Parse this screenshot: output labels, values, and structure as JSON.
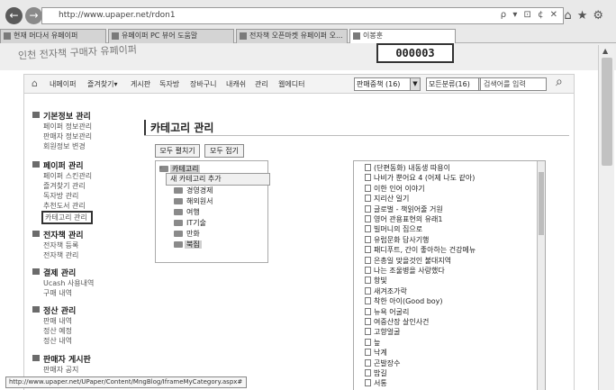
{
  "browser": {
    "url": "http://www.upaper.net/rdon1",
    "address_controls": "ρ ▾ ⊡ ¢ ✕",
    "tabs": [
      {
        "label": "현재 머다서 유페이퍼"
      },
      {
        "label": "유페이퍼 PC 뷰어 도움말"
      },
      {
        "label": "전자책 오픈마켓 유페이퍼 오..."
      },
      {
        "label": "이봉훈"
      }
    ],
    "toolbar_icons": [
      "home-icon",
      "star-icon",
      "gear-icon"
    ]
  },
  "banner": {
    "faded_text": "인천 전자책 구매자 유페이퍼",
    "counter": "000003"
  },
  "menubar": {
    "items": [
      "내페이퍼",
      "즐겨찾기▾",
      "게시판",
      "독자방",
      "장바구니",
      "내캐쉬",
      "관리",
      "웹에디터"
    ],
    "select1": "판매중책 (16)",
    "select2": "모든분류(16)",
    "search_text": "검색어를 입력"
  },
  "sidebar": {
    "sections": [
      {
        "title": "기본정보 관리",
        "items": [
          "페이퍼 정보관리",
          "판매자 정보관리",
          "회원정보 변경"
        ]
      },
      {
        "title": "페이퍼 관리",
        "items": [
          "페이퍼 스킨관리",
          "즐겨찾기 관리",
          "독자방 관리",
          "추천도서 관리",
          "카테고리 관리"
        ]
      },
      {
        "title": "전자책 관리",
        "items": [
          "전자책 등록",
          "전자책 관리"
        ]
      },
      {
        "title": "결제 관리",
        "items": [
          "Ucash 사용내역",
          "구매 내역"
        ]
      },
      {
        "title": "정산 관리",
        "items": [
          "판매 내역",
          "정산 예정",
          "정산 내역"
        ]
      },
      {
        "title": "판매자 게시판",
        "items": [
          "판매자 공지"
        ]
      }
    ]
  },
  "main": {
    "title": "카테고리 관리",
    "btn_expand": "모두 펼치기",
    "btn_collapse": "모두 접기",
    "popup": "새 카테고리 추가",
    "tree": {
      "root": "카테고리",
      "children": [
        "경영경제",
        "해외원서",
        "여행",
        "IT기술",
        "만화",
        "북집"
      ]
    },
    "list": [
      "(단편동화) 내동생 따용이",
      "나비가 뿐어요 4 (어제 나도 같아)",
      "이한 인어 이야기",
      "지리산 일기",
      "글로벌 - 책읽어줄 거원",
      "영어 관용표현의 유래1",
      "빌머니의 집으로",
      "유럽문화 답사기행",
      "패디푸트, 간이 좋아하는 건강메뉴",
      "은총일 맞을것인 불대지역",
      "나는 조울병을 사랑했다",
      "항빛",
      "새겨조가락",
      "착한 아이(Good boy)",
      "뉴욕 어굴리",
      "여중산장 살인사건",
      "고향얼굴",
      "늪",
      "낙계",
      "곤발장수",
      "밥길",
      "서통"
    ]
  },
  "status_url": "http://www.upaper.net/UPaper/Content/MngBlog/IframeMyCategory.aspx#"
}
